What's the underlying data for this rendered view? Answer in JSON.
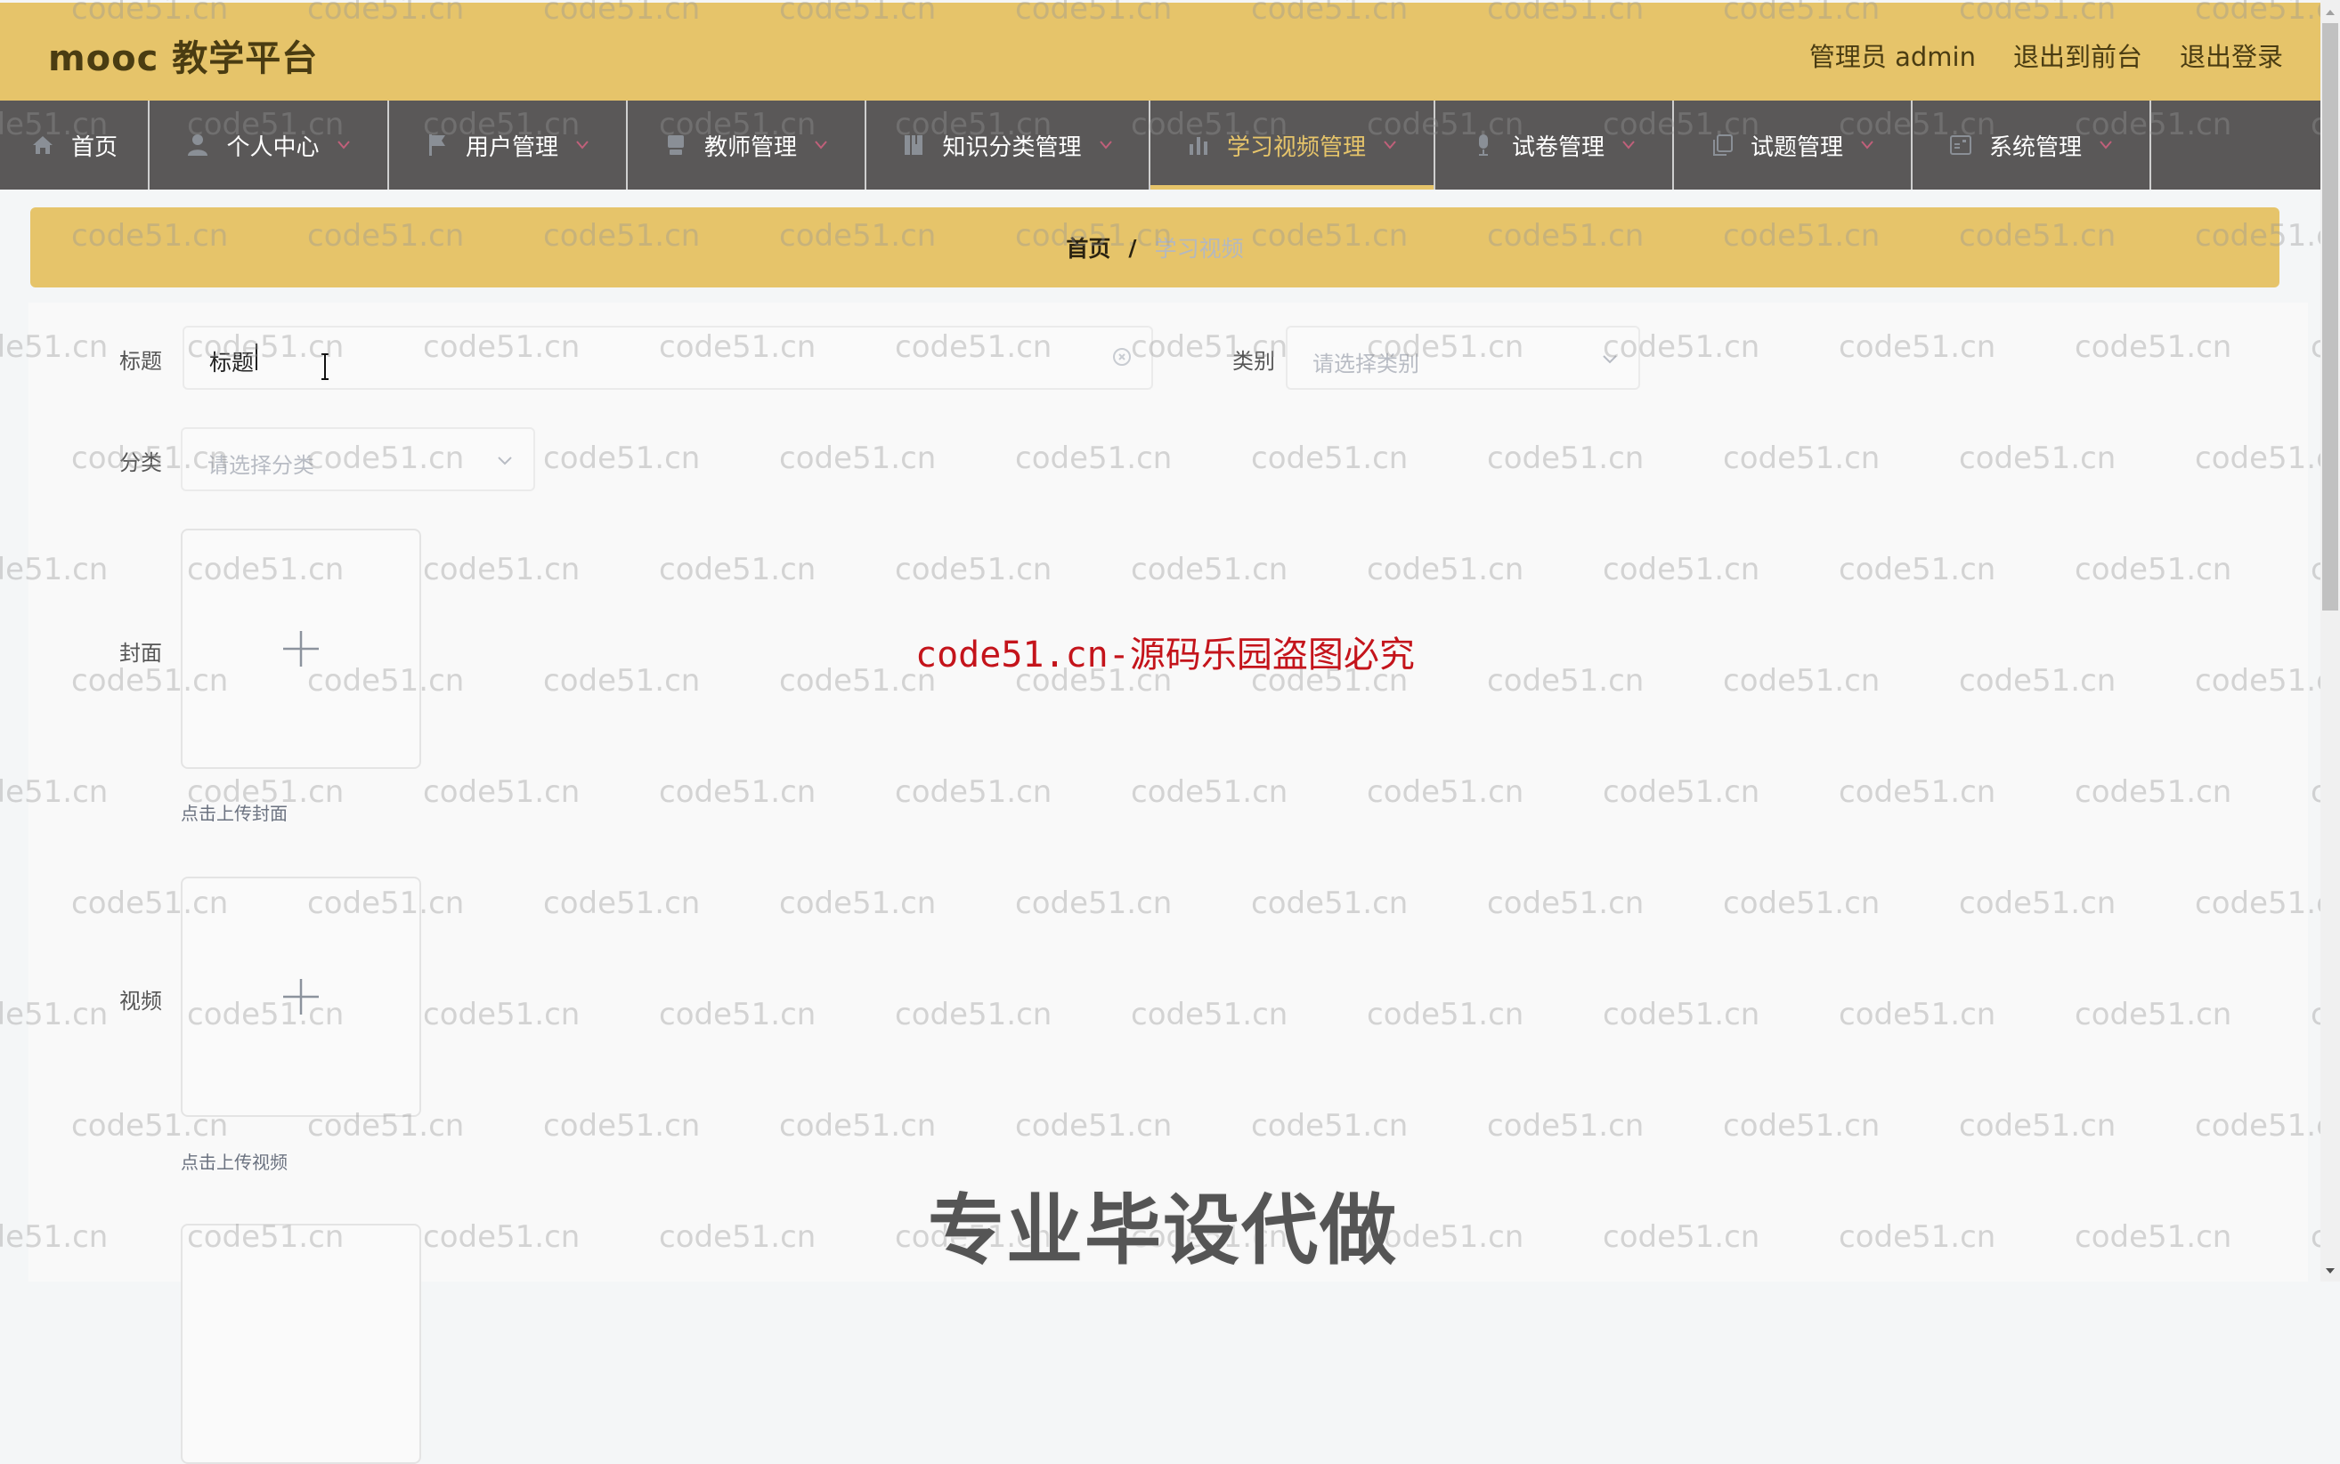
{
  "app": {
    "title": "mooc 教学平台"
  },
  "header": {
    "user_label": "管理员 admin",
    "to_frontend": "退出到前台",
    "logout": "退出登录"
  },
  "nav": {
    "items": [
      {
        "label": "首页",
        "icon": "home-icon",
        "has_dropdown": false,
        "active": false
      },
      {
        "label": "个人中心",
        "icon": "user-icon",
        "has_dropdown": true,
        "active": false
      },
      {
        "label": "用户管理",
        "icon": "flag-icon",
        "has_dropdown": true,
        "active": false
      },
      {
        "label": "教师管理",
        "icon": "teacher-icon",
        "has_dropdown": true,
        "active": false
      },
      {
        "label": "知识分类管理",
        "icon": "book-icon",
        "has_dropdown": true,
        "active": false
      },
      {
        "label": "学习视频管理",
        "icon": "bar-chart-icon",
        "has_dropdown": true,
        "active": true
      },
      {
        "label": "试卷管理",
        "icon": "microphone-icon",
        "has_dropdown": true,
        "active": false
      },
      {
        "label": "试题管理",
        "icon": "copy-icon",
        "has_dropdown": true,
        "active": false
      },
      {
        "label": "系统管理",
        "icon": "panel-icon",
        "has_dropdown": true,
        "active": false
      }
    ],
    "accent_color": "#e6c46a",
    "chevron_color": "#c0607a"
  },
  "breadcrumb": {
    "home": "首页",
    "separator": "/",
    "current": "学习视频"
  },
  "form": {
    "title_field": {
      "label": "标题",
      "value": "标题"
    },
    "category_field": {
      "label": "类别",
      "placeholder": "请选择类别"
    },
    "classification_field": {
      "label": "分类",
      "placeholder": "请选择分类"
    },
    "cover_upload": {
      "label": "封面",
      "hint": "点击上传封面"
    },
    "video_upload": {
      "label": "视频",
      "hint": "点击上传视频"
    }
  },
  "overlays": {
    "watermark_text": "code51.cn",
    "red_notice": "code51.cn-源码乐园盗图必究",
    "promo_text": "专业毕设代做"
  },
  "colors": {
    "header_bg": "#e6c46a",
    "nav_bg": "#5a5858",
    "red_notice": "#c4141b"
  }
}
